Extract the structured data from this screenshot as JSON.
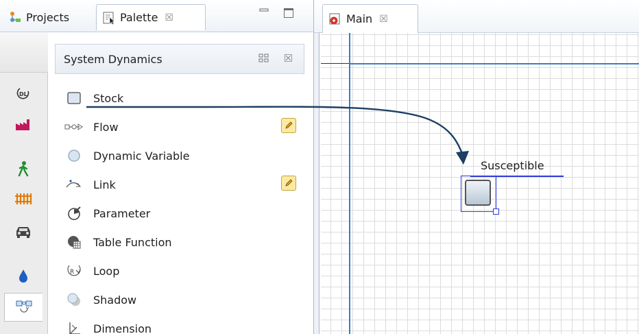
{
  "left_view": {
    "tabs": [
      {
        "label": "Projects"
      },
      {
        "label": "Palette",
        "close": "☒"
      }
    ],
    "palette_header": {
      "title": "System Dynamics",
      "close": "☒",
      "grid": "▫▫"
    },
    "palette_items": [
      {
        "label": "Stock",
        "icon": "stock-icon"
      },
      {
        "label": "Flow",
        "icon": "flow-icon",
        "editable": true
      },
      {
        "label": "Dynamic Variable",
        "icon": "dynamic-variable-icon"
      },
      {
        "label": "Link",
        "icon": "link-icon",
        "editable": true
      },
      {
        "label": "Parameter",
        "icon": "parameter-icon"
      },
      {
        "label": "Table Function",
        "icon": "table-function-icon"
      },
      {
        "label": "Loop",
        "icon": "loop-icon"
      },
      {
        "label": "Shadow",
        "icon": "shadow-icon"
      },
      {
        "label": "Dimension",
        "icon": "dimension-icon"
      }
    ],
    "drawer_icons": [
      "statechart-icon",
      "process-modeling-icon",
      "pedestrian-icon",
      "rail-icon",
      "road-traffic-icon",
      "fluid-icon",
      "system-dynamics-icon"
    ]
  },
  "editor": {
    "tab": {
      "label": "Main",
      "close": "☒"
    },
    "canvas": {
      "stock_name": "Susceptible"
    }
  },
  "colors": {
    "axis": "#3d7bc4",
    "selection": "#2d3ad8",
    "drag_arrow": "#1d3f63",
    "grid": "#dcdcdc"
  }
}
